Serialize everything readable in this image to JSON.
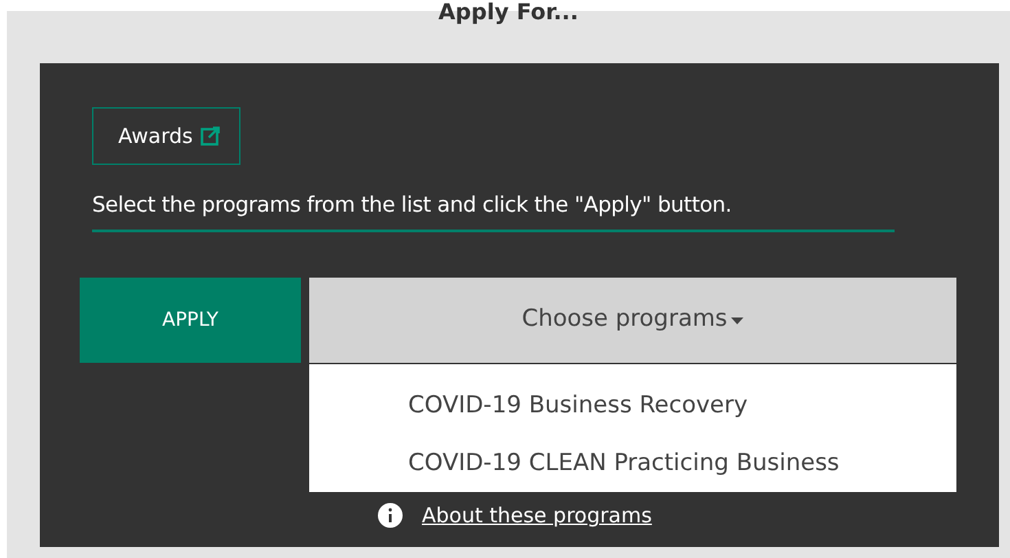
{
  "title": "Apply For...",
  "awards_link": {
    "label": "Awards"
  },
  "instruction": "Select the programs from the list and click the \"Apply\" button.",
  "apply_button": {
    "label": "APPLY"
  },
  "dropdown": {
    "label": "Choose programs",
    "expanded": true,
    "options": [
      {
        "label": "COVID-19 Business Recovery"
      },
      {
        "label": "COVID-19 CLEAN Practicing Business"
      }
    ]
  },
  "about_link": {
    "label": "About these programs"
  }
}
